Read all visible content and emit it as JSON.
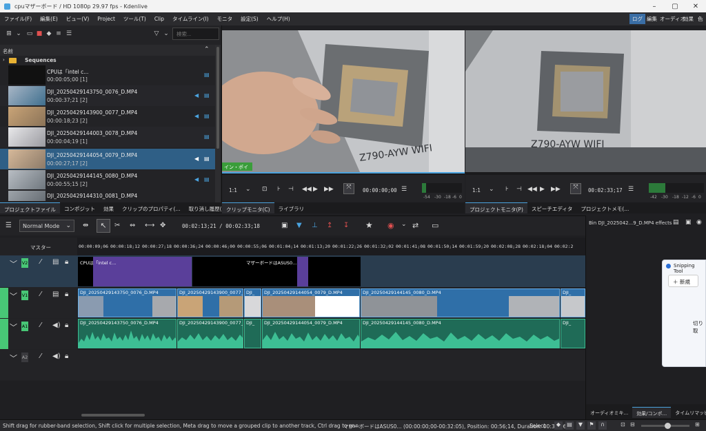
{
  "window": {
    "title": "cpuマザーボード / HD 1080p 29.97 fps - Kdenlive"
  },
  "menu": {
    "items": [
      "ファイル(F)",
      "編集(E)",
      "ビュー(V)",
      "Project",
      "ツール(T)",
      "Clip",
      "タイムライン(I)",
      "モニタ",
      "設定(S)",
      "ヘルプ(H)"
    ],
    "workspaces": [
      "ログ",
      "編集",
      "オーディオ",
      "効果",
      "色"
    ]
  },
  "bin": {
    "search_placeholder": "検索...",
    "header": "名前",
    "folder": "Sequences",
    "clips": [
      {
        "name": "CPUは「intel c...",
        "duration": "00:00:05;00 [1]"
      },
      {
        "name": "DJI_20250429143750_0076_D.MP4",
        "duration": "00:00:37;21 [2]"
      },
      {
        "name": "DJI_20250429143900_0077_D.MP4",
        "duration": "00:00:18;23 [2]"
      },
      {
        "name": "DJI_20250429144003_0078_D.MP4",
        "duration": "00:00:04;19 [1]"
      },
      {
        "name": "DJI_20250429144054_0079_D.MP4",
        "duration": "00:00:27;17 [2]"
      },
      {
        "name": "DJI_20250429144145_0080_D.MP4",
        "duration": "00:00:55;15 [2]"
      },
      {
        "name": "DJI_20250429144310_0081_D.MP4",
        "duration": ""
      }
    ],
    "tabs": [
      "プロジェクトファイル",
      "コンポジット",
      "効果",
      "クリップのプロパティ(...",
      "取り消し履歴(..."
    ]
  },
  "clip_monitor": {
    "in_point": "イン・ポイント",
    "zoom": "1:1",
    "timecode": "00:00:00;00",
    "meter_labels": [
      "-54",
      "-30",
      "-18",
      "-6",
      "0"
    ],
    "tabs": [
      "クリップモニタ(C)",
      "ライブラリ"
    ]
  },
  "project_monitor": {
    "zoom": "1:1",
    "timecode": "00:02:33;17",
    "meter_labels": [
      "-42",
      "-30",
      "-18",
      "-12",
      "-6",
      "0"
    ],
    "tabs": [
      "プロジェクトモニタ(P)",
      "スピーチエディタ",
      "プロジェクトメモ(..."
    ]
  },
  "timeline": {
    "edit_mode": "Normal Mode",
    "position": "00:02:13;21 / 00:02:33;18",
    "master": "マスター",
    "ruler": [
      "00:00:09;06",
      "00:00:18;12",
      "00:00:27;18",
      "00:00:36;24",
      "00:00:46;00",
      "00:00:55;06",
      "00:01:04;14",
      "00:01:13;20",
      "00:01:22;26",
      "00:01:32;02",
      "00:01:41;08",
      "00:01:50;14",
      "00:01:59;20",
      "00:02:08;28",
      "00:02:18;04",
      "00:02:2"
    ],
    "tracks": {
      "v2": "V2",
      "v1": "V1",
      "a1": "A1",
      "a2": "A2"
    },
    "v2_clips": [
      "CPUは「intel c...",
      "マザーボードはASUS0...",
      ""
    ],
    "v1_clips": [
      "DJI_20250429143750_0076_D.MP4",
      "DJI_20250429143900_0077_D",
      "DJI_",
      "DJI_20250429144054_0079_D.MP4",
      "DJI_20250429144145_0080_D.MP4",
      "DJI_"
    ],
    "a1_clips": [
      "DJI_20250429143750_0076_D.MP4",
      "DJI_20250429143900_0077_D",
      "DJI_",
      "DJI_20250429144054_0079_D.MP4",
      "DJI_20250429144145_0080_D.MP4",
      "DJI_"
    ]
  },
  "right_panel": {
    "title": "Bin DJI_2025042...9_D.MP4 effects",
    "tabs": [
      "オーディオミキ...",
      "効果/コンポ...",
      "タイムリマッピ..."
    ]
  },
  "snipping": {
    "title": "Snipping Tool",
    "new_label": "新規",
    "body": "切り取"
  },
  "status": {
    "hint": "Shift drag for rubber-band selection, Shift click for multiple selection, Meta drag to move a grouped clip to another track, Ctrl drag to pan",
    "info": "マザーボードはASUS0... (00:00:00;00-00:32:05), Position: 00:56;14, Duration: 00:32:06",
    "mode": "Select"
  },
  "colors": {
    "accent": "#4aa3df",
    "video_clip": "#2f6fa8",
    "audio_clip": "#1f6b57",
    "title_clip": "#5a3f9a"
  }
}
